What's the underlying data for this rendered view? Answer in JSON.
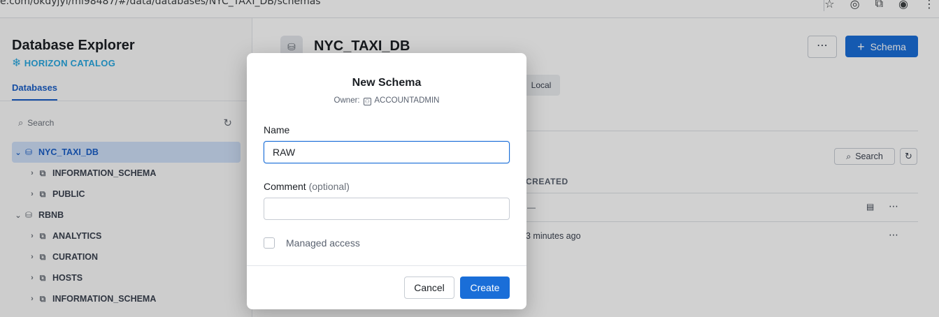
{
  "browser": {
    "url_visible": "e.com/okdyjyi/mi98487/#/data/databases/NYC_TAXI_DB/schemas",
    "icons": [
      "star-icon",
      "extension-icon",
      "puzzle-icon",
      "profile-icon",
      "menu-dots-icon"
    ]
  },
  "sidebar": {
    "title": "Database Explorer",
    "catalog_label": "HORIZON CATALOG",
    "tab": "Databases",
    "search_placeholder": "Search",
    "tree": [
      {
        "label": "NYC_TAXI_DB",
        "level": 0,
        "expanded": true,
        "selected": true,
        "icon": "database-icon"
      },
      {
        "label": "INFORMATION_SCHEMA",
        "level": 1,
        "icon": "schema-icon"
      },
      {
        "label": "PUBLIC",
        "level": 1,
        "icon": "schema-icon"
      },
      {
        "label": "RBNB",
        "level": 0,
        "expanded": true,
        "icon": "database-icon"
      },
      {
        "label": "ANALYTICS",
        "level": 1,
        "icon": "schema-icon"
      },
      {
        "label": "CURATION",
        "level": 1,
        "icon": "schema-icon"
      },
      {
        "label": "HOSTS",
        "level": 1,
        "icon": "schema-icon"
      },
      {
        "label": "INFORMATION_SCHEMA",
        "level": 1,
        "icon": "schema-icon"
      }
    ]
  },
  "main": {
    "db_title": "NYC_TAXI_DB",
    "more_label": "⋯",
    "schema_button": "Schema",
    "chip_local": "Local",
    "search_button": "Search",
    "column_created": "CREATED",
    "rows": [
      {
        "created": "—"
      },
      {
        "created": "3 minutes ago"
      }
    ]
  },
  "modal": {
    "title": "New Schema",
    "owner_label": "Owner:",
    "owner_value": "ACCOUNTADMIN",
    "name_label": "Name",
    "name_value": "RAW",
    "comment_label": "Comment",
    "comment_optional": "(optional)",
    "comment_value": "",
    "managed_access_label": "Managed access",
    "managed_access_checked": false,
    "cancel_label": "Cancel",
    "create_label": "Create"
  },
  "colors": {
    "accent": "#1a6ed8",
    "catalog": "#29a8e0",
    "selected_bg": "#cfe0f8"
  }
}
